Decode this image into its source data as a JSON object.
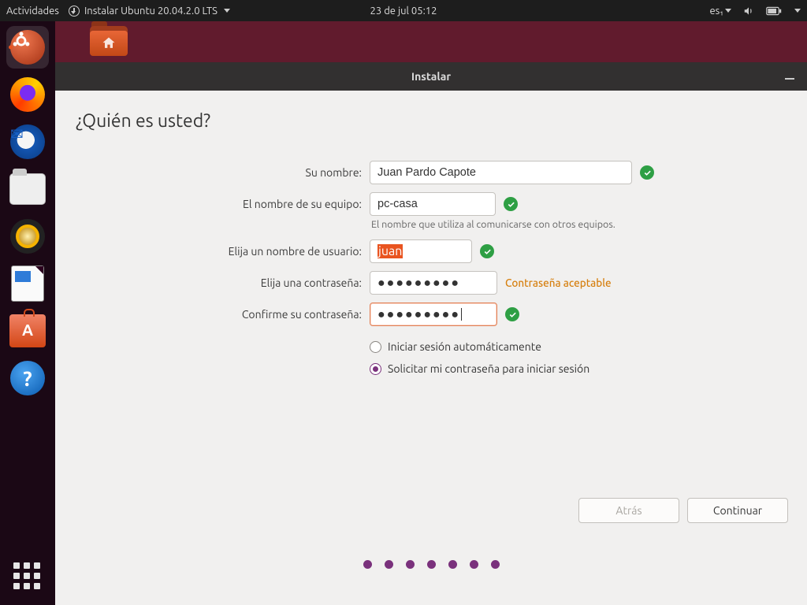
{
  "topbar": {
    "activities": "Actividades",
    "app_title": "Instalar Ubuntu 20.04.2.0 LTS",
    "datetime": "23 de jul  05:12",
    "lang_indicator": "es₁"
  },
  "installer": {
    "window_title": "Instalar",
    "heading": "¿Quién es usted?",
    "labels": {
      "name": "Su nombre:",
      "hostname": "El nombre de su equipo:",
      "hostname_hint": "El nombre que utiliza al comunicarse con otros equipos.",
      "username": "Elija un nombre de usuario:",
      "password": "Elija una contraseña:",
      "confirm": "Confirme su contraseña:"
    },
    "values": {
      "name": "Juan Pardo Capote",
      "hostname": "pc-casa",
      "username": "juan",
      "password": "●●●●●●●●●",
      "confirm": "●●●●●●●●●"
    },
    "password_strength": "Contraseña aceptable",
    "options": {
      "auto_login": "Iniciar sesión automáticamente",
      "require_password": "Solicitar mi contraseña para iniciar sesión"
    },
    "buttons": {
      "back": "Atrás",
      "continue": "Continuar"
    }
  }
}
